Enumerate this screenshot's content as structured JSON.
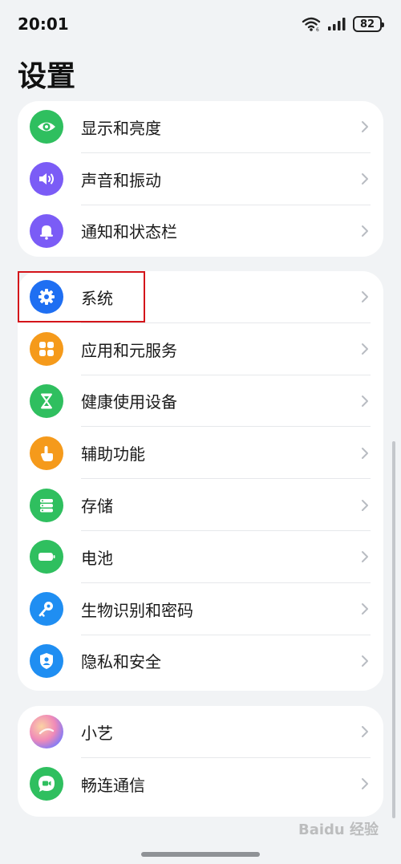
{
  "status_bar": {
    "time": "20:01",
    "battery": "82"
  },
  "page": {
    "title": "设置"
  },
  "groups": [
    {
      "items": [
        {
          "label": "显示和亮度",
          "icon": "eye-icon",
          "color": "#2fbf5f"
        },
        {
          "label": "声音和振动",
          "icon": "speaker-icon",
          "color": "#7b5cf6"
        },
        {
          "label": "通知和状态栏",
          "icon": "bell-icon",
          "color": "#7b5cf6"
        }
      ]
    },
    {
      "items": [
        {
          "label": "系统",
          "icon": "gear-icon",
          "color": "#1f6ff2"
        },
        {
          "label": "应用和元服务",
          "icon": "apps-grid-icon",
          "color": "#f59a1b"
        },
        {
          "label": "健康使用设备",
          "icon": "hourglass-icon",
          "color": "#2fbf5f"
        },
        {
          "label": "辅助功能",
          "icon": "hand-touch-icon",
          "color": "#f59a1b"
        },
        {
          "label": "存储",
          "icon": "storage-icon",
          "color": "#2fbf5f"
        },
        {
          "label": "电池",
          "icon": "battery-icon",
          "color": "#2fbf5f"
        },
        {
          "label": "生物识别和密码",
          "icon": "key-icon",
          "color": "#1f8ef2"
        },
        {
          "label": "隐私和安全",
          "icon": "shield-person-icon",
          "color": "#1f8ef2"
        }
      ]
    },
    {
      "items": [
        {
          "label": "小艺",
          "icon": "assistant-orb-icon",
          "color": "#f08ab8"
        },
        {
          "label": "畅连通信",
          "icon": "video-call-icon",
          "color": "#2fbf5f"
        }
      ]
    }
  ],
  "highlight": {
    "target": "系统",
    "color": "#d4141a"
  },
  "watermark": "Baidu 经验"
}
